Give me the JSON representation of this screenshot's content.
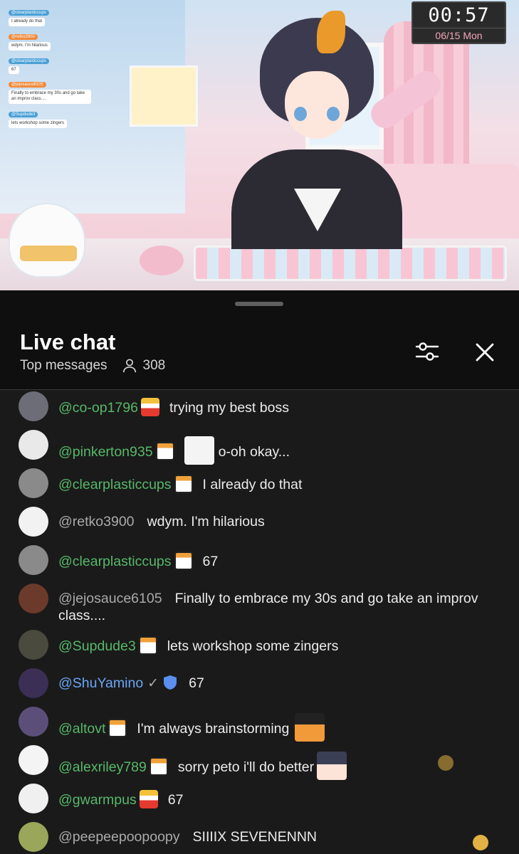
{
  "stream": {
    "clock_time": "00:57",
    "clock_date": "06/15 Mon",
    "overlay_chat": [
      {
        "name": "@clearplasticcups",
        "message": "I already do that",
        "color": "blue"
      },
      {
        "name": "@retko3900",
        "message": "wdym. I'm hilarious",
        "color": "orange"
      },
      {
        "name": "@clearplasticcups",
        "message": "67",
        "color": "blue"
      },
      {
        "name": "@jejosauce6105",
        "message": "Finally to embrace my 30s and go take an improv class....",
        "color": "orange"
      },
      {
        "name": "@Supdude3",
        "message": "lets workshop some zingers",
        "color": "blue"
      }
    ]
  },
  "chat": {
    "title": "Live chat",
    "mode": "Top messages",
    "viewer_count": "308",
    "messages": [
      {
        "author": "@co-op1796",
        "text": "trying my best boss",
        "author_style": "member",
        "badge": "crown",
        "avatar_color": "#6d6d78"
      },
      {
        "author": "@pinkerton935",
        "text": "o-oh okay...",
        "author_style": "member",
        "badge": "dark",
        "emote_before": "sweat-emote",
        "avatar_color": "#e9e9e9"
      },
      {
        "author": "@clearplasticcups",
        "text": "I already do that",
        "author_style": "member",
        "badge": "dark",
        "avatar_color": "#8a8a8a"
      },
      {
        "author": "@retko3900",
        "text": "wdym. I'm hilarious",
        "author_style": "plain",
        "avatar_color": "#f2f2f2"
      },
      {
        "author": "@clearplasticcups",
        "text": "67",
        "author_style": "member",
        "badge": "dark",
        "avatar_color": "#8a8a8a"
      },
      {
        "author": "@jejosauce6105",
        "text": "Finally to embrace my 30s and go take an improv class....",
        "author_style": "plain",
        "avatar_color": "#6b3a2a"
      },
      {
        "author": "@Supdude3",
        "text": "lets workshop some zingers",
        "author_style": "member",
        "badge": "dark",
        "avatar_color": "#4a4a3e"
      },
      {
        "author": "@ShuYamino",
        "text": "67",
        "author_style": "moderator",
        "avatar_color": "#3b2f55"
      },
      {
        "author": "@altovt",
        "text": "I'm always brainstorming",
        "author_style": "member",
        "badge": "dark",
        "emote_after": "sunglasses-penguin-emote",
        "avatar_color": "#5b4f7a"
      },
      {
        "author": "@alexriley789",
        "text": "sorry peto i'll do better",
        "author_style": "member",
        "badge": "dark",
        "emote_after": "crying-emote",
        "avatar_color": "#f4f4f4"
      },
      {
        "author": "@gwarmpus",
        "text": "67",
        "author_style": "member",
        "badge": "crown",
        "avatar_color": "#f0f0f0"
      },
      {
        "author": "@peepeepoopoopy",
        "text": "SIIIIX SEVENENNN",
        "author_style": "plain",
        "avatar_color": "#9aa65a"
      }
    ]
  },
  "icons": {
    "filter": "sliders-icon",
    "close": "close-icon",
    "viewers": "person-icon"
  },
  "colors": {
    "member_name": "#57b86a",
    "moderator_name": "#6aa6f5",
    "plain_name": "#aaaaaa",
    "background": "#0f0f0f"
  }
}
